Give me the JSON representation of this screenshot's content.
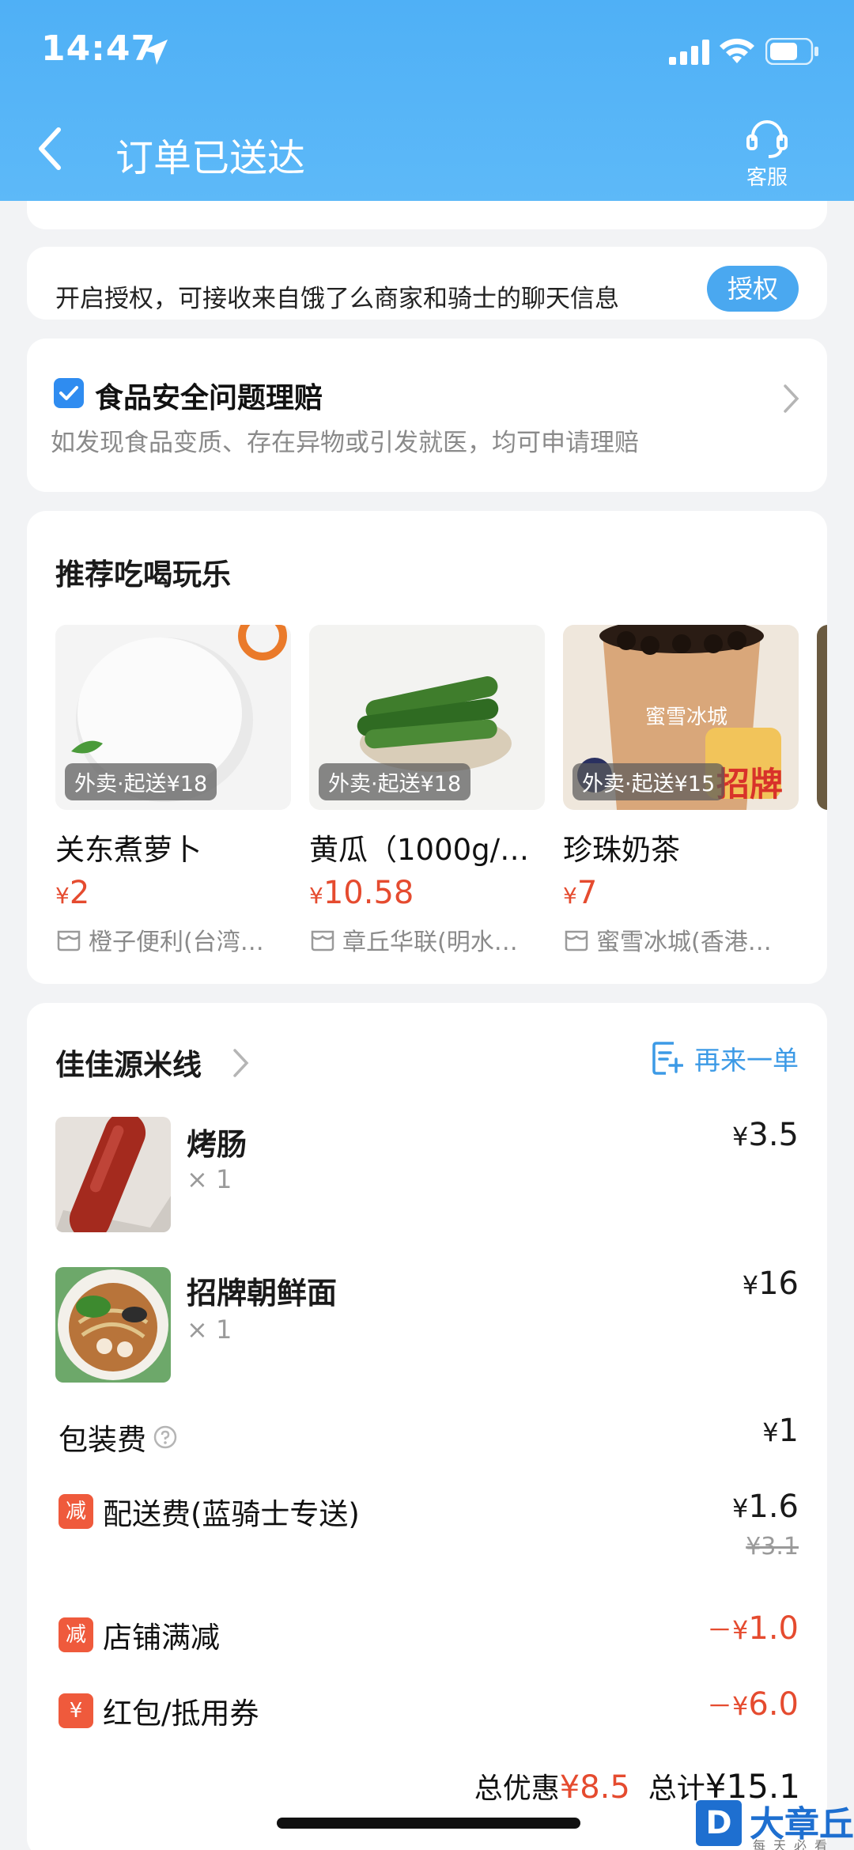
{
  "status_bar": {
    "time": "14:47"
  },
  "nav": {
    "title": "订单已送达",
    "customer_service": "客服"
  },
  "auth": {
    "text": "开启授权，可接收来自饿了么商家和骑士的聊天信息",
    "button": "授权"
  },
  "safety": {
    "title": "食品安全问题理赔",
    "subtitle": "如发现食品变质、存在异物或引发就医，均可申请理赔"
  },
  "recommend": {
    "title": "推荐吃喝玩乐",
    "items": [
      {
        "tag": "外卖·起送¥18",
        "name": "关东煮萝卜",
        "yen": "¥",
        "price": "2",
        "shop": "橙子便利(台湾…"
      },
      {
        "tag": "外卖·起送¥18",
        "name": "黄瓜（1000g/…",
        "yen": "¥",
        "price": "10.58",
        "shop": "章丘华联(明水…"
      },
      {
        "tag": "外卖·起送¥15",
        "name": "珍珠奶茶",
        "yen": "¥",
        "price": "7",
        "shop": "蜜雪冰城(香港…",
        "badge": "招牌",
        "brand": "蜜雪冰城"
      }
    ]
  },
  "order": {
    "shop_name": "佳佳源米线",
    "reorder": "再来一单",
    "items": [
      {
        "name": "烤肠",
        "qty": "× 1",
        "yen": "¥",
        "price": "3.5"
      },
      {
        "name": "招牌朝鲜面",
        "qty": "× 1",
        "yen": "¥",
        "price": "16"
      }
    ],
    "packaging": {
      "label": "包装费",
      "yen": "¥",
      "value": "1"
    },
    "delivery": {
      "badge": "减",
      "label": "配送费(蓝骑士专送)",
      "yen": "¥",
      "value": "1.6",
      "original": "¥3.1"
    },
    "shop_discount": {
      "badge": "减",
      "label": "店铺满减",
      "prefix": "－¥",
      "value": "1.0"
    },
    "coupon": {
      "badge": "¥",
      "label": "红包/抵用券",
      "prefix": "－¥",
      "value": "6.0"
    },
    "summary": {
      "discount_label": "总优惠",
      "discount_value": "¥8.5",
      "total_label": "总计",
      "total_value": "¥15.1"
    }
  },
  "watermark": {
    "letter": "D",
    "name": "大章丘",
    "sub": "每天必看"
  },
  "colors": {
    "header": "#4fb0f6",
    "accent": "#3c9ae6",
    "price_red": "#e54b2f",
    "badge_red": "#ef5a3c"
  }
}
